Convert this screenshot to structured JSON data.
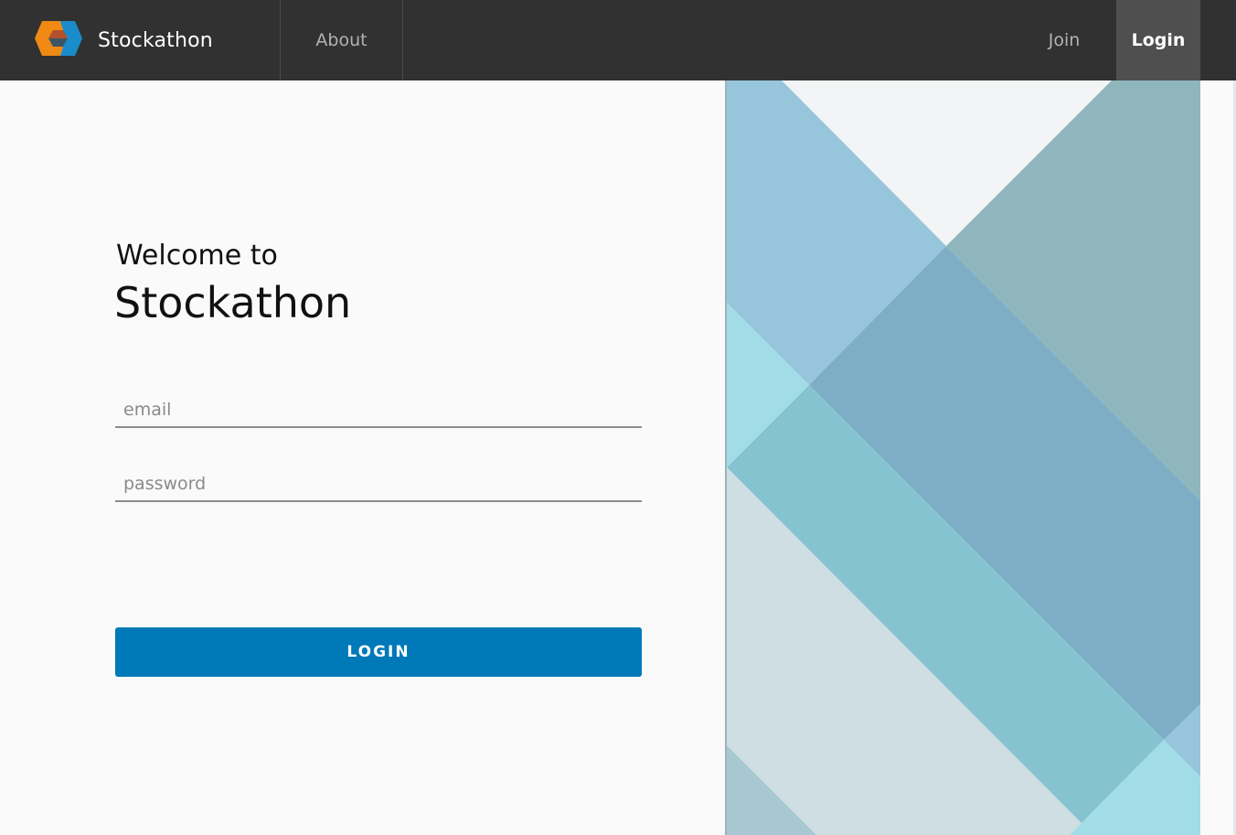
{
  "header": {
    "app_name": "Stockathon",
    "nav": {
      "about": "About",
      "join": "Join",
      "login": "Login"
    }
  },
  "login": {
    "welcome": "Welcome to",
    "title": "Stockathon",
    "email_placeholder": "email",
    "password_placeholder": "password",
    "email_value": "",
    "password_value": "",
    "button_label": "LOGIN"
  },
  "colors": {
    "header_bg": "#313131",
    "active_nav_bg": "#4f4f4f",
    "button_bg": "#0079b8",
    "page_bg": "#fafafa"
  },
  "icons": [
    "logo-icon"
  ]
}
